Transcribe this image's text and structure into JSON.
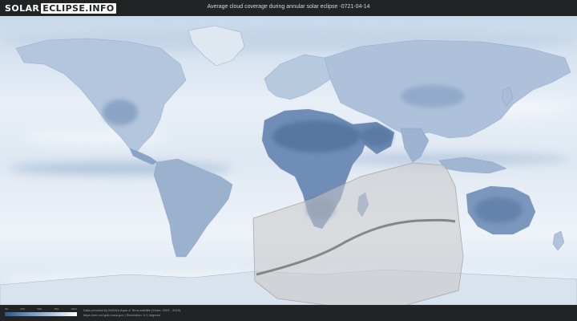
{
  "header": {
    "logo_solar": "SOLAR",
    "logo_eclipse": "ECLIPSE.INFO",
    "title": "Average cloud coverage during annular solar eclipse -0721-04-14"
  },
  "legend": {
    "ticks": [
      "0%",
      "25%",
      "50%",
      "75%",
      "100%"
    ],
    "colors": [
      "#2f5886",
      "#6f93be",
      "#b3c8e0",
      "#ffffff"
    ]
  },
  "credits": {
    "line1": "Data provided by NASA's Aqua & Terra satellite (Years: 2003 - 2019)",
    "line2": "https://neo.sci.gsfc.nasa.gov | Resolution: 0.1 degrees"
  },
  "map": {
    "ocean_color": "#e3ebf4",
    "land_clear_color": "#5b7ba7",
    "eclipse_zone_color": "#c9c9c9",
    "central_line_color": "#777777"
  }
}
